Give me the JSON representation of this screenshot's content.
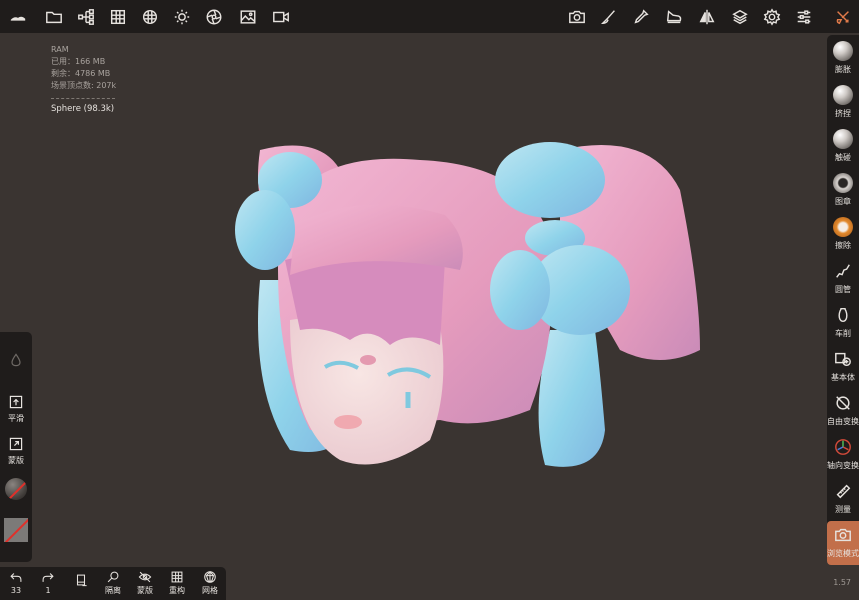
{
  "top_toolbar": {
    "left_icons": [
      "logo-icon",
      "folder-icon",
      "hierarchy-icon",
      "grid-icon",
      "texture-icon",
      "light-icon",
      "film-icon",
      "image-icon",
      "video-icon"
    ],
    "right_icons": [
      "camera-icon",
      "brush-icon",
      "dropper-icon",
      "boot-icon",
      "symmetry-icon",
      "layers-icon",
      "settings-icon",
      "sliders-icon",
      "tools-icon"
    ]
  },
  "stats": {
    "ram_label": "RAM",
    "used": "已用：166 MB",
    "free": "剩余：4786 MB",
    "vertices": "场景顶点数: 207k",
    "mesh_name": "Sphere (98.3k)"
  },
  "right_tools": [
    {
      "label": "膨胀",
      "icon": "inflate-icon"
    },
    {
      "label": "挤捏",
      "icon": "pinch-icon"
    },
    {
      "label": "触碰",
      "icon": "smudge-icon"
    },
    {
      "label": "图章",
      "icon": "stamp-icon"
    },
    {
      "label": "擦除",
      "icon": "erase-icon"
    },
    {
      "label": "圆管",
      "icon": "tube-icon"
    },
    {
      "label": "车削",
      "icon": "lathe-icon"
    },
    {
      "label": "基本体",
      "icon": "primitive-icon"
    },
    {
      "label": "自由变换",
      "icon": "free-transform-icon"
    },
    {
      "label": "轴向变换",
      "icon": "gizmo-icon"
    },
    {
      "label": "测量",
      "icon": "ruler-icon"
    },
    {
      "label": "浏览模式",
      "icon": "camera-icon"
    }
  ],
  "version": "1.57",
  "left_panel": {
    "smooth_label": "平滑",
    "mask_label": "蒙版"
  },
  "bottom_toolbar": {
    "undo_count": "33",
    "redo_count": "1",
    "isolate_label": "隔离",
    "mask_label": "蒙版",
    "remesh_label": "重构",
    "wireframe_label": "网格"
  },
  "colors": {
    "accent": "#c26f4a",
    "toolbar_bg": "#1f1c1b",
    "viewport_bg": "#3a3431",
    "hair_pink": "#e7a3c4",
    "ribbon_blue": "#8fd3ea"
  }
}
